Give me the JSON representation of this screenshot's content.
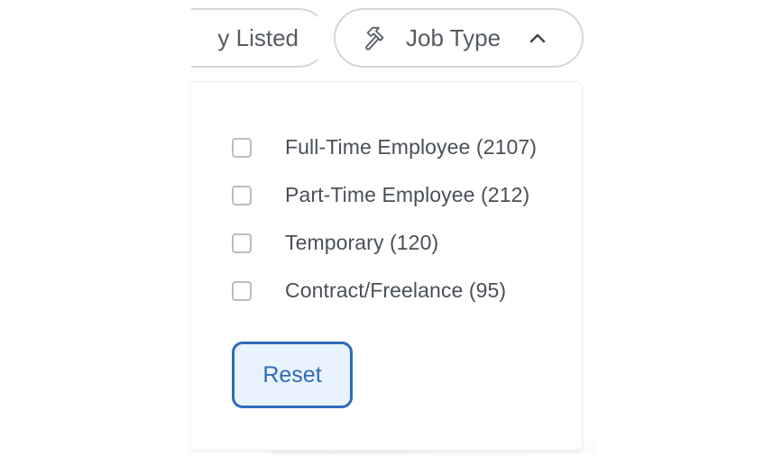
{
  "filters": {
    "listed_pill": {
      "label": "Listed",
      "visible_fragment": "y Listed"
    },
    "job_type_pill": {
      "label": "Job Type",
      "icon": "hammer-icon",
      "state_icon": "chevron-up-icon"
    }
  },
  "dropdown": {
    "options": [
      {
        "label": "Full-Time Employee (2107)",
        "checked": false
      },
      {
        "label": "Part-Time Employee (212)",
        "checked": false
      },
      {
        "label": "Temporary (120)",
        "checked": false
      },
      {
        "label": "Contract/Freelance (95)",
        "checked": false
      }
    ],
    "reset_label": "Reset"
  },
  "colors": {
    "accent": "#2f6bb9",
    "accent_bg": "#e9f3fd",
    "text": "#4a5058",
    "border": "#d3d7db"
  }
}
